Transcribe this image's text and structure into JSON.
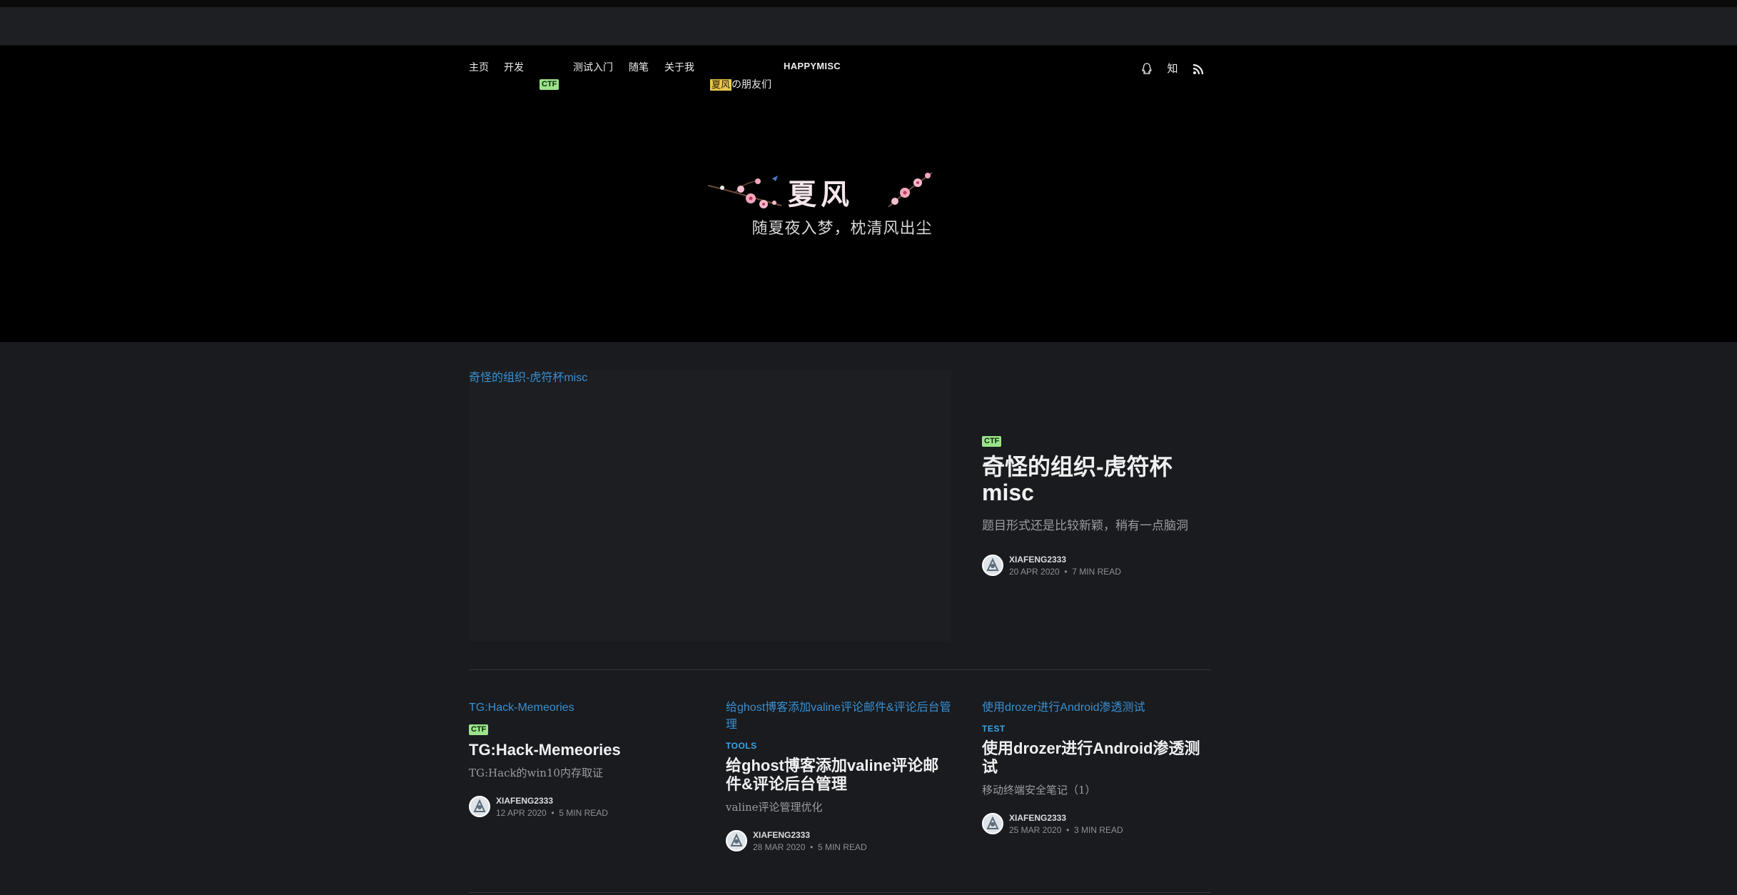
{
  "nav": {
    "items": [
      "主页",
      "开发",
      "CTF",
      "测试入门",
      "随笔",
      "关于我",
      "夏风",
      "の朋友们",
      "HAPPYMISC"
    ],
    "icons": [
      "qq-icon",
      "zhihu-icon",
      "rss-icon"
    ],
    "zhihu_glyph": "知"
  },
  "hero": {
    "logo_text": "夏风",
    "tagline": "随夏夜入梦，枕清风出尘"
  },
  "featured": {
    "image_alt": "奇怪的组织-虎符杯misc",
    "tag": "CTF",
    "title": "奇怪的组织-虎符杯misc",
    "excerpt": "题目形式还是比较新颖，稍有一点脑洞",
    "author": "XIAFENG2333",
    "date": "20 APR 2020",
    "read_time": "7 MIN READ"
  },
  "posts": [
    {
      "image_alt": "TG:Hack-Memeories",
      "tag": "CTF",
      "title": "TG:Hack-Memeories",
      "excerpt": "TG:Hack的win10内存取证",
      "author": "XIAFENG2333",
      "date": "12 APR 2020",
      "read_time": "5 MIN READ"
    },
    {
      "image_alt": "给ghost博客添加valine评论邮件&评论后台管理",
      "tag": "TOOLS",
      "title": "给ghost博客添加valine评论邮件&评论后台管理",
      "excerpt": "valine评论管理优化",
      "author": "XIAFENG2333",
      "date": "28 MAR 2020",
      "read_time": "5 MIN READ"
    },
    {
      "image_alt": "使用drozer进行Android渗透测试",
      "tag": "TEST",
      "title": "使用drozer进行Android渗透测试",
      "excerpt": "移动终端安全笔记（1）",
      "author": "XIAFENG2333",
      "date": "25 MAR 2020",
      "read_time": "3 MIN READ"
    }
  ],
  "meta_separator": "•",
  "colors": {
    "accent_green": "#9be38a",
    "accent_yellow": "#e8c74c",
    "link_blue": "#3aa4e6",
    "background": "#191b1f"
  }
}
